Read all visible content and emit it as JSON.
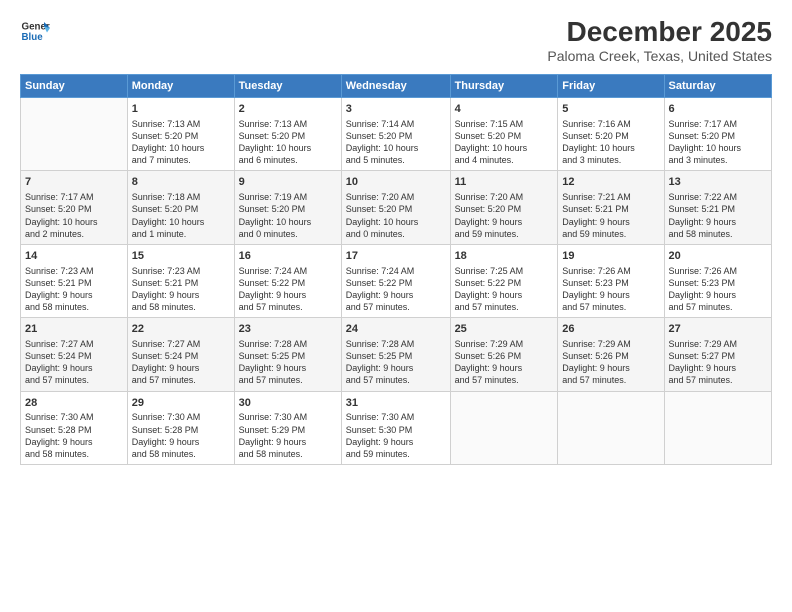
{
  "header": {
    "logo_line1": "General",
    "logo_line2": "Blue",
    "title": "December 2025",
    "subtitle": "Paloma Creek, Texas, United States"
  },
  "days_of_week": [
    "Sunday",
    "Monday",
    "Tuesday",
    "Wednesday",
    "Thursday",
    "Friday",
    "Saturday"
  ],
  "weeks": [
    [
      {
        "num": "",
        "info": ""
      },
      {
        "num": "1",
        "info": "Sunrise: 7:13 AM\nSunset: 5:20 PM\nDaylight: 10 hours\nand 7 minutes."
      },
      {
        "num": "2",
        "info": "Sunrise: 7:13 AM\nSunset: 5:20 PM\nDaylight: 10 hours\nand 6 minutes."
      },
      {
        "num": "3",
        "info": "Sunrise: 7:14 AM\nSunset: 5:20 PM\nDaylight: 10 hours\nand 5 minutes."
      },
      {
        "num": "4",
        "info": "Sunrise: 7:15 AM\nSunset: 5:20 PM\nDaylight: 10 hours\nand 4 minutes."
      },
      {
        "num": "5",
        "info": "Sunrise: 7:16 AM\nSunset: 5:20 PM\nDaylight: 10 hours\nand 3 minutes."
      },
      {
        "num": "6",
        "info": "Sunrise: 7:17 AM\nSunset: 5:20 PM\nDaylight: 10 hours\nand 3 minutes."
      }
    ],
    [
      {
        "num": "7",
        "info": "Sunrise: 7:17 AM\nSunset: 5:20 PM\nDaylight: 10 hours\nand 2 minutes."
      },
      {
        "num": "8",
        "info": "Sunrise: 7:18 AM\nSunset: 5:20 PM\nDaylight: 10 hours\nand 1 minute."
      },
      {
        "num": "9",
        "info": "Sunrise: 7:19 AM\nSunset: 5:20 PM\nDaylight: 10 hours\nand 0 minutes."
      },
      {
        "num": "10",
        "info": "Sunrise: 7:20 AM\nSunset: 5:20 PM\nDaylight: 10 hours\nand 0 minutes."
      },
      {
        "num": "11",
        "info": "Sunrise: 7:20 AM\nSunset: 5:20 PM\nDaylight: 9 hours\nand 59 minutes."
      },
      {
        "num": "12",
        "info": "Sunrise: 7:21 AM\nSunset: 5:21 PM\nDaylight: 9 hours\nand 59 minutes."
      },
      {
        "num": "13",
        "info": "Sunrise: 7:22 AM\nSunset: 5:21 PM\nDaylight: 9 hours\nand 58 minutes."
      }
    ],
    [
      {
        "num": "14",
        "info": "Sunrise: 7:23 AM\nSunset: 5:21 PM\nDaylight: 9 hours\nand 58 minutes."
      },
      {
        "num": "15",
        "info": "Sunrise: 7:23 AM\nSunset: 5:21 PM\nDaylight: 9 hours\nand 58 minutes."
      },
      {
        "num": "16",
        "info": "Sunrise: 7:24 AM\nSunset: 5:22 PM\nDaylight: 9 hours\nand 57 minutes."
      },
      {
        "num": "17",
        "info": "Sunrise: 7:24 AM\nSunset: 5:22 PM\nDaylight: 9 hours\nand 57 minutes."
      },
      {
        "num": "18",
        "info": "Sunrise: 7:25 AM\nSunset: 5:22 PM\nDaylight: 9 hours\nand 57 minutes."
      },
      {
        "num": "19",
        "info": "Sunrise: 7:26 AM\nSunset: 5:23 PM\nDaylight: 9 hours\nand 57 minutes."
      },
      {
        "num": "20",
        "info": "Sunrise: 7:26 AM\nSunset: 5:23 PM\nDaylight: 9 hours\nand 57 minutes."
      }
    ],
    [
      {
        "num": "21",
        "info": "Sunrise: 7:27 AM\nSunset: 5:24 PM\nDaylight: 9 hours\nand 57 minutes."
      },
      {
        "num": "22",
        "info": "Sunrise: 7:27 AM\nSunset: 5:24 PM\nDaylight: 9 hours\nand 57 minutes."
      },
      {
        "num": "23",
        "info": "Sunrise: 7:28 AM\nSunset: 5:25 PM\nDaylight: 9 hours\nand 57 minutes."
      },
      {
        "num": "24",
        "info": "Sunrise: 7:28 AM\nSunset: 5:25 PM\nDaylight: 9 hours\nand 57 minutes."
      },
      {
        "num": "25",
        "info": "Sunrise: 7:29 AM\nSunset: 5:26 PM\nDaylight: 9 hours\nand 57 minutes."
      },
      {
        "num": "26",
        "info": "Sunrise: 7:29 AM\nSunset: 5:26 PM\nDaylight: 9 hours\nand 57 minutes."
      },
      {
        "num": "27",
        "info": "Sunrise: 7:29 AM\nSunset: 5:27 PM\nDaylight: 9 hours\nand 57 minutes."
      }
    ],
    [
      {
        "num": "28",
        "info": "Sunrise: 7:30 AM\nSunset: 5:28 PM\nDaylight: 9 hours\nand 58 minutes."
      },
      {
        "num": "29",
        "info": "Sunrise: 7:30 AM\nSunset: 5:28 PM\nDaylight: 9 hours\nand 58 minutes."
      },
      {
        "num": "30",
        "info": "Sunrise: 7:30 AM\nSunset: 5:29 PM\nDaylight: 9 hours\nand 58 minutes."
      },
      {
        "num": "31",
        "info": "Sunrise: 7:30 AM\nSunset: 5:30 PM\nDaylight: 9 hours\nand 59 minutes."
      },
      {
        "num": "",
        "info": ""
      },
      {
        "num": "",
        "info": ""
      },
      {
        "num": "",
        "info": ""
      }
    ]
  ]
}
